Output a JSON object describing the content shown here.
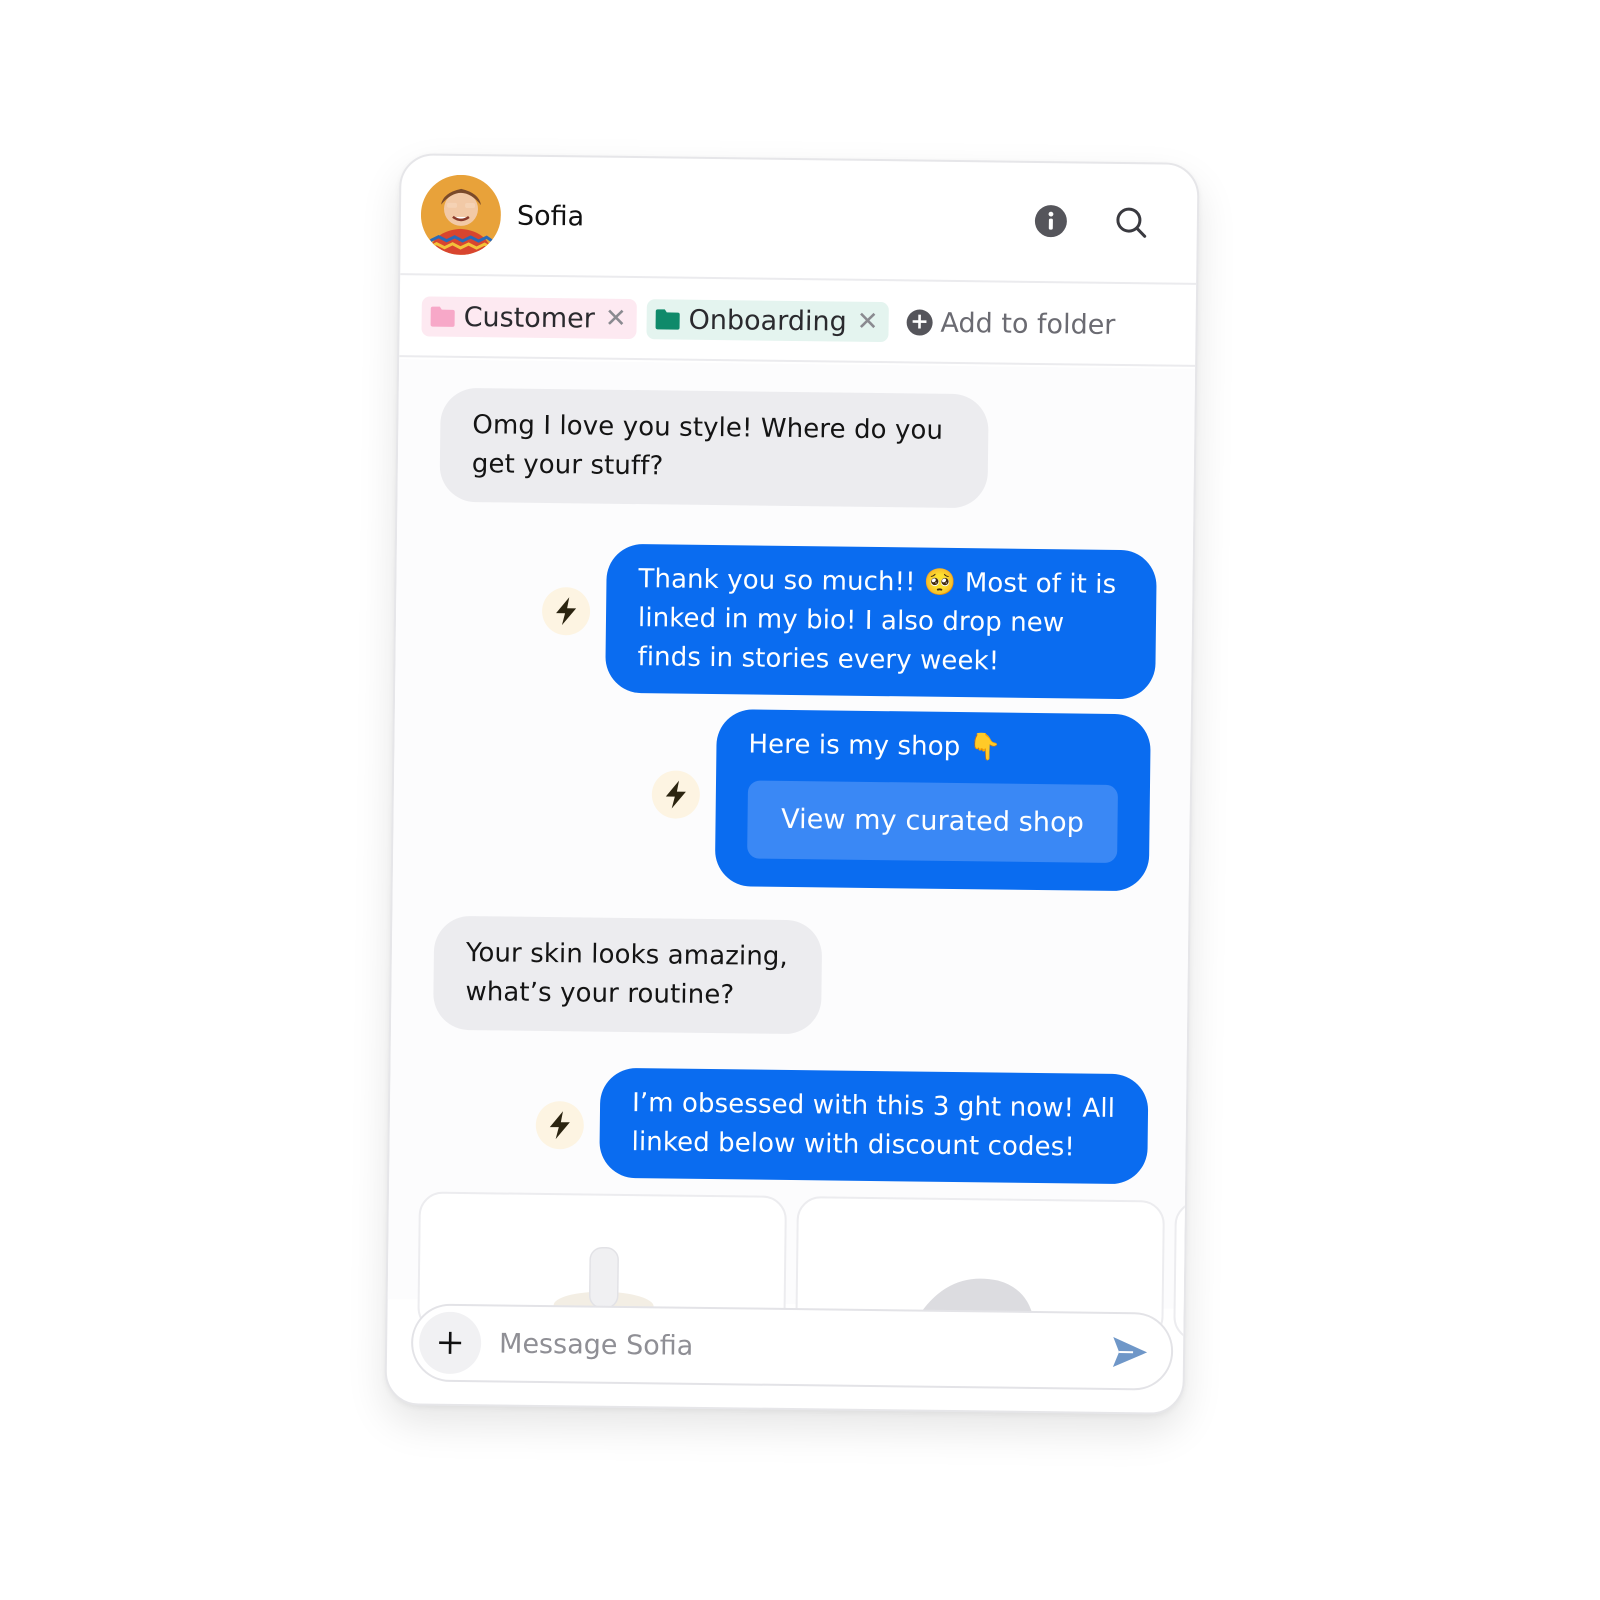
{
  "contact": {
    "name": "Sofia"
  },
  "folders": {
    "items": [
      {
        "label": "Customer",
        "color": "#f7a8c8"
      },
      {
        "label": "Onboarding",
        "color": "#0f8a6a"
      }
    ],
    "add_label": "Add to folder"
  },
  "messages": [
    {
      "side": "incoming",
      "text": "Omg I love you style! Where do you get your stuff?"
    },
    {
      "side": "outgoing",
      "text": "Thank you so much!! 🥺 Most of it is linked in my bio! I also drop new finds in stories every week!"
    },
    {
      "side": "outgoing",
      "text": "Here is my shop 👇",
      "button_label": "View my curated shop"
    },
    {
      "side": "incoming",
      "text": "Your skin looks amazing, what’s your routine?"
    },
    {
      "side": "outgoing",
      "text": "I’m obsessed with this 3 ght now! All linked below with discount codes!"
    }
  ],
  "composer": {
    "placeholder": "Message Sofia"
  },
  "colors": {
    "accent": "#0a6cf0",
    "incoming_bubble": "#ececef",
    "bolt_bg": "#fdf4e2"
  },
  "icons": [
    "info-icon",
    "search-icon",
    "folder-icon",
    "close-icon",
    "plus-icon",
    "bolt-icon",
    "send-icon"
  ]
}
